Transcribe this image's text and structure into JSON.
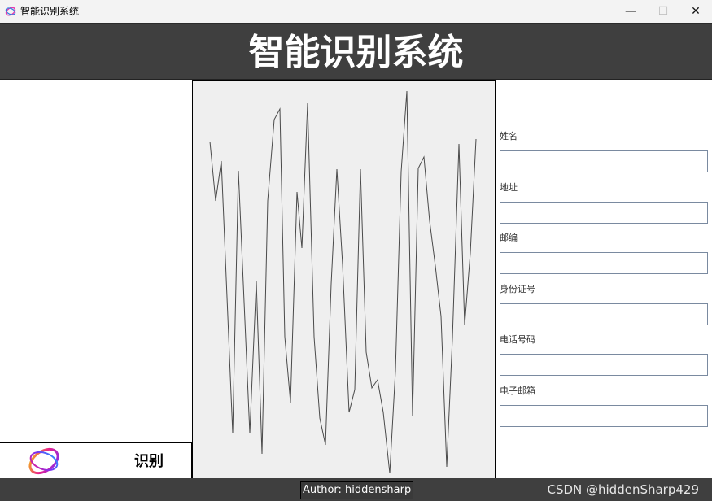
{
  "window": {
    "title": "智能识别系统",
    "minimize_glyph": "—",
    "maximize_glyph": "☐",
    "close_glyph": "✕"
  },
  "header": {
    "title": "智能识别系统",
    "background": "#3f3f3f"
  },
  "left_panel": {
    "logo_icon": "ring-logo-icon",
    "recognize_label": "识别"
  },
  "center_panel": {
    "background": "#efefef",
    "waveform_icon": "signal-waveform"
  },
  "form": {
    "fields": [
      {
        "label": "姓名",
        "value": ""
      },
      {
        "label": "地址",
        "value": ""
      },
      {
        "label": "邮编",
        "value": ""
      },
      {
        "label": "身份证号",
        "value": ""
      },
      {
        "label": "电话号码",
        "value": ""
      },
      {
        "label": "电子邮箱",
        "value": ""
      }
    ]
  },
  "footer": {
    "author": "Author: hiddensharp",
    "watermark": "CSDN @hiddenSharp429"
  }
}
